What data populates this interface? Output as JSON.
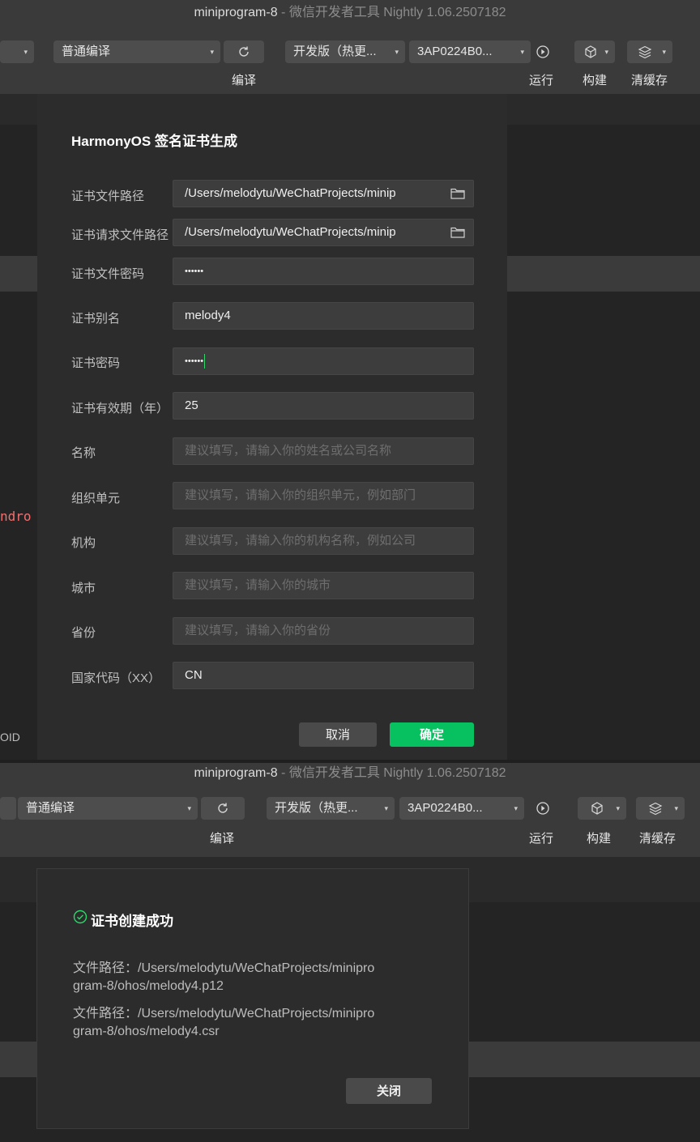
{
  "window": {
    "project_name": "miniprogram-8",
    "separator": " - ",
    "app_name": "微信开发者工具 Nightly 1.06.2507182"
  },
  "toolbar": {
    "compile_mode": "普通编译",
    "compile_label": "编译",
    "version_select": "开发版（热更...",
    "device_select": "3AP0224B0...",
    "run_label": "运行",
    "build_label": "构建",
    "clear_cache_label": "清缓存"
  },
  "background": {
    "code_fragment": "ndro",
    "id_fragment": "OID"
  },
  "cert_dialog": {
    "title": "HarmonyOS 签名证书生成",
    "fields": [
      {
        "label": "证书文件路径",
        "value": "/Users/melodytu/WeChatProjects/minip",
        "placeholder": ""
      },
      {
        "label": "证书请求文件路径",
        "value": "/Users/melodytu/WeChatProjects/minip",
        "placeholder": ""
      },
      {
        "label": "证书文件密码",
        "value": "••••••",
        "placeholder": ""
      },
      {
        "label": "证书别名",
        "value": "melody4",
        "placeholder": ""
      },
      {
        "label": "证书密码",
        "value": "••••••",
        "placeholder": ""
      },
      {
        "label": "证书有效期（年）",
        "value": "25",
        "placeholder": ""
      },
      {
        "label": "名称",
        "value": "",
        "placeholder": "建议填写，请输入你的姓名或公司名称"
      },
      {
        "label": "组织单元",
        "value": "",
        "placeholder": "建议填写，请输入你的组织单元，例如部门"
      },
      {
        "label": "机构",
        "value": "",
        "placeholder": "建议填写，请输入你的机构名称，例如公司"
      },
      {
        "label": "城市",
        "value": "",
        "placeholder": "建议填写，请输入你的城市"
      },
      {
        "label": "省份",
        "value": "",
        "placeholder": "建议填写，请输入你的省份"
      },
      {
        "label": "国家代码（XX）",
        "value": "CN",
        "placeholder": ""
      }
    ],
    "cancel_label": "取消",
    "ok_label": "确定"
  },
  "success_dialog": {
    "title": "证书创建成功",
    "lines": [
      "文件路径：/Users/melodytu/WeChatProjects/minipro",
      "gram-8/ohos/melody4.p12",
      "文件路径：/Users/melodytu/WeChatProjects/minipro",
      "gram-8/ohos/melody4.csr"
    ],
    "close_label": "关闭"
  },
  "colors": {
    "accent_green": "#07c160",
    "success_icon": "#2cd86a",
    "code_red": "#f07070"
  },
  "icons": {
    "compile": "refresh-icon",
    "run": "play-icon",
    "build": "cube-icon",
    "clear_cache": "layers-icon",
    "browse": "folder-icon",
    "success": "check-circle-icon"
  }
}
